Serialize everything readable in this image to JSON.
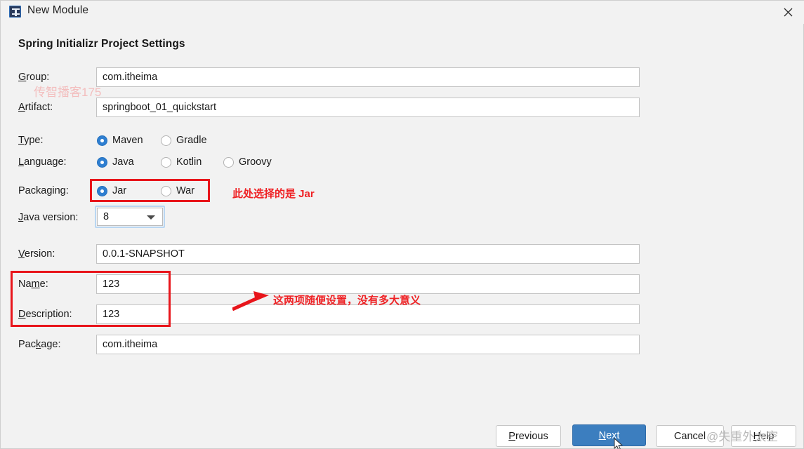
{
  "window": {
    "title": "New Module",
    "icon": "intellij-module-icon",
    "close_icon": "close-icon"
  },
  "heading": "Spring Initializr Project Settings",
  "fields": {
    "group": {
      "label": "Group:",
      "label_mnemonic": "G",
      "value": "com.itheima"
    },
    "artifact": {
      "label": "Artifact:",
      "label_mnemonic": "A",
      "value": "springboot_01_quickstart"
    },
    "version": {
      "label": "Version:",
      "label_mnemonic": "V",
      "value": "0.0.1-SNAPSHOT"
    },
    "name": {
      "label": "Name:",
      "label_mnemonic": "m",
      "value": "123"
    },
    "description": {
      "label": "Description:",
      "label_mnemonic": "D",
      "value": "123"
    },
    "package": {
      "label": "Package:",
      "label_mnemonic": "k",
      "value": "com.itheima"
    }
  },
  "type": {
    "label": "Type:",
    "options": [
      {
        "label": "Maven",
        "selected": true
      },
      {
        "label": "Gradle",
        "selected": false
      }
    ]
  },
  "language": {
    "label": "Language:",
    "options": [
      {
        "label": "Java",
        "selected": true
      },
      {
        "label": "Kotlin",
        "selected": false
      },
      {
        "label": "Groovy",
        "selected": false
      }
    ]
  },
  "packaging": {
    "label": "Packaging:",
    "options": [
      {
        "label": "Jar",
        "selected": true
      },
      {
        "label": "War",
        "selected": false
      }
    ]
  },
  "java_version": {
    "label": "Java version:",
    "value": "8",
    "caret_icon": "chevron-down-icon"
  },
  "annotations": {
    "packaging_note": "此处选择的是 Jar",
    "name_desc_note": "这两项随便设置，没有多大意义",
    "box_color": "#e8151b",
    "text_color": "#ef2225"
  },
  "buttons": {
    "previous": "Previous",
    "next": "Next",
    "cancel": "Cancel",
    "help": "Help",
    "primary_color": "#3c7ebf"
  },
  "watermarks": {
    "top": "传智播客175",
    "bottom": "@失重外太空"
  }
}
